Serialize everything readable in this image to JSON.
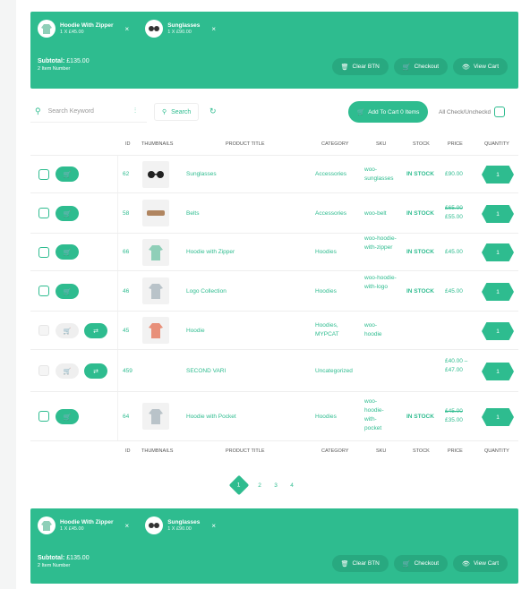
{
  "cart": {
    "items": [
      {
        "name": "Hoodie With Zipper",
        "qty": "1 X £45.00",
        "remove": "×",
        "icon": "hoodie-thumbnail"
      },
      {
        "name": "Sunglasses",
        "qty": "1 X £90.00",
        "remove": "×",
        "icon": "sunglasses-thumbnail"
      }
    ],
    "subtotal_label": "Subtotal:",
    "subtotal_value": "£135.00",
    "item_count": "2 Item Number",
    "clear_label": "Clear BTN",
    "checkout_label": "Checkout",
    "view_cart_label": "View Cart"
  },
  "toolbar": {
    "search_placeholder": "Search Keyword",
    "search_label": "Search",
    "add_to_cart_label": "Add To Cart 0 Items",
    "all_check_label": "All Check/Uncheckd"
  },
  "table": {
    "headers": [
      "ID",
      "THUMBNAILS",
      "PRODUCT TITLE",
      "CATEGORY",
      "SKU",
      "STOCK",
      "PRICE",
      "QUANTITY"
    ],
    "rows": [
      {
        "id": "62",
        "title": "Sunglasses",
        "category": "Accessories",
        "sku": "woo-sunglasses",
        "stock": "IN STOCK",
        "price_old": "",
        "price": "£90.00",
        "qty": "1",
        "thumb": "sunglasses"
      },
      {
        "id": "58",
        "title": "Belts",
        "category": "Accessories",
        "sku": "woo-belt",
        "stock": "IN STOCK",
        "price_old": "£65.00",
        "price": "£55.00",
        "qty": "1",
        "thumb": "belt"
      },
      {
        "id": "66",
        "title": "Hoodie with Zipper",
        "category": "Hoodies",
        "sku": "woo-hoodie-with-zipper",
        "stock": "IN STOCK",
        "price_old": "",
        "price": "£45.00",
        "qty": "1",
        "thumb": "hoodie"
      },
      {
        "id": "46",
        "title": "Logo Collection",
        "category": "Hoodies",
        "sku": "woo-hoodie-with-logo",
        "stock": "IN STOCK",
        "price_old": "",
        "price": "£45.00",
        "qty": "1",
        "thumb": "hoodie"
      },
      {
        "id": "45",
        "title": "Hoodie",
        "category": "Hoodies, MYPCAT",
        "sku": "woo-hoodie",
        "stock": "",
        "price_old": "",
        "price": "",
        "qty": "1",
        "thumb": "hoodie-red"
      },
      {
        "id": "459",
        "title": "SECOND VARI",
        "category": "Uncategorized",
        "sku": "",
        "stock": "",
        "price_old": "",
        "price": "£40.00 – £47.00",
        "qty": "1",
        "thumb": ""
      },
      {
        "id": "64",
        "title": "Hoodie with Pocket",
        "category": "Hoodies",
        "sku": "woo-hoodie-with-pocket",
        "stock": "IN STOCK",
        "price_old": "£45.00",
        "price": "£35.00",
        "qty": "1",
        "thumb": "hoodie"
      }
    ]
  },
  "pagination": {
    "pages": [
      "1",
      "2",
      "3",
      "4"
    ],
    "current": "1"
  },
  "colors": {
    "accent": "#2ebc8f"
  }
}
